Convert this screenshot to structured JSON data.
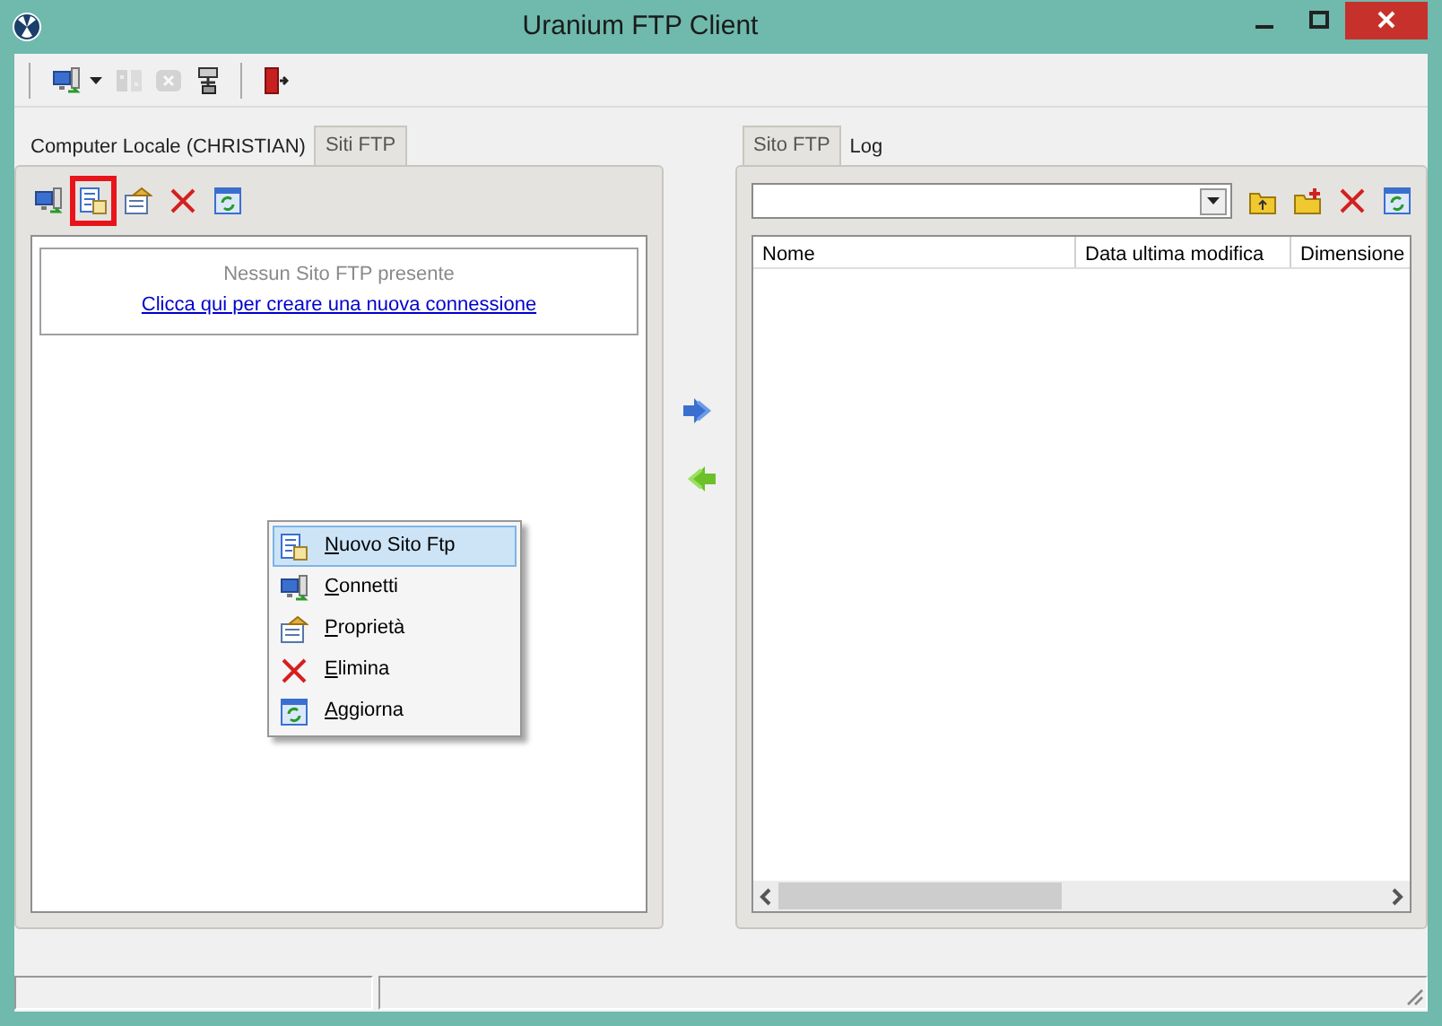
{
  "window": {
    "title": "Uranium FTP Client"
  },
  "toolbar": [
    {
      "kind": "connect",
      "disabled": false,
      "dropdown": true
    },
    {
      "kind": "disconnect",
      "disabled": true,
      "dropdown": false
    },
    {
      "kind": "stop",
      "disabled": true,
      "dropdown": false
    },
    {
      "kind": "settings",
      "disabled": false,
      "dropdown": false
    },
    {
      "kind": "separator"
    },
    {
      "kind": "exit",
      "disabled": false,
      "dropdown": false
    }
  ],
  "left_panel": {
    "tabs": [
      {
        "label": "Computer Locale (CHRISTIAN)",
        "selected": false
      },
      {
        "label": "Siti FTP",
        "selected": true
      }
    ],
    "toolbar": [
      {
        "kind": "connect",
        "highlighted": false
      },
      {
        "kind": "new",
        "highlighted": true
      },
      {
        "kind": "properties",
        "highlighted": false
      },
      {
        "kind": "delete",
        "highlighted": false
      },
      {
        "kind": "refresh",
        "highlighted": false
      }
    ],
    "empty_message": "Nessun Sito FTP presente",
    "create_link": "Clicca qui per creare una nuova connessione"
  },
  "transfer_buttons": [
    {
      "kind": "upload"
    },
    {
      "kind": "download"
    }
  ],
  "context_menu": {
    "items": [
      {
        "kind": "new",
        "label": "Nuovo Sito Ftp",
        "selected": true
      },
      {
        "kind": "connect",
        "label": "Connetti",
        "selected": false
      },
      {
        "kind": "properties",
        "label": "Proprietà",
        "selected": false
      },
      {
        "kind": "delete",
        "label": "Elimina",
        "selected": false
      },
      {
        "kind": "refresh",
        "label": "Aggiorna",
        "selected": false
      }
    ]
  },
  "right_panel": {
    "tabs": [
      {
        "label": "Sito FTP",
        "selected": true
      },
      {
        "label": "Log",
        "selected": false
      }
    ],
    "toolbar": [
      {
        "kind": "folder-up"
      },
      {
        "kind": "folder-new"
      },
      {
        "kind": "delete"
      },
      {
        "kind": "refresh"
      }
    ],
    "table": {
      "columns": [
        "Nome",
        "Data ultima modifica",
        "Dimensione"
      ]
    }
  }
}
